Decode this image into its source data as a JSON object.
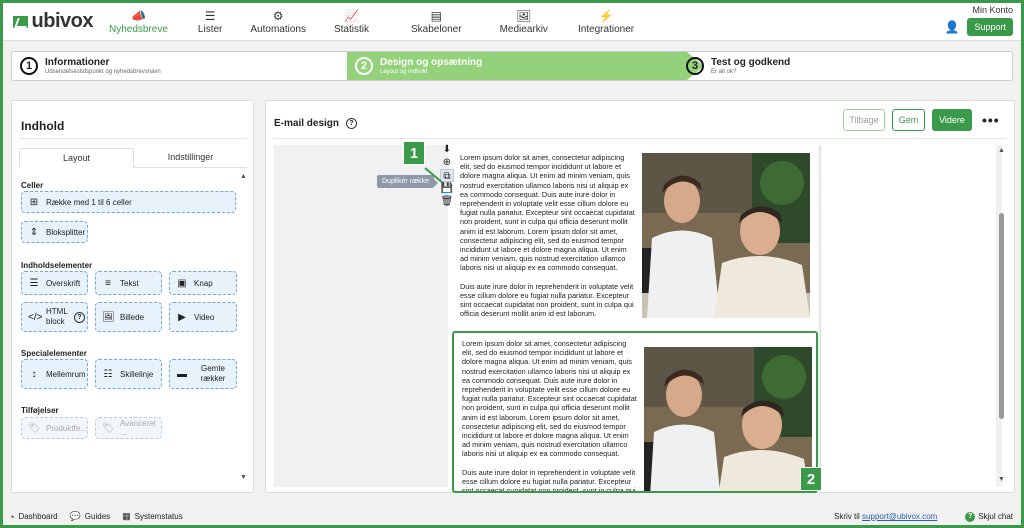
{
  "brand": {
    "name": "ubivox",
    "accent": "#3a9a4a"
  },
  "nav": {
    "items": [
      {
        "label": "Nyhedsbreve",
        "icon": "megaphone-icon",
        "active": true
      },
      {
        "label": "Lister",
        "icon": "list-icon"
      },
      {
        "label": "Automations",
        "icon": "cogs-icon"
      },
      {
        "label": "Statistik",
        "icon": "chart-icon"
      },
      {
        "label": "Skabeloner",
        "icon": "template-icon"
      },
      {
        "label": "Mediearkiv",
        "icon": "image-icon"
      },
      {
        "label": "Integrationer",
        "icon": "plug-icon"
      }
    ],
    "account_label": "Min Konto",
    "support_label": "Support"
  },
  "stepper": {
    "steps": [
      {
        "num": "1",
        "title": "Informationer",
        "sub": "Udsendelsestidspunkt og nyhedsbrevsnavn"
      },
      {
        "num": "2",
        "title": "Design og opsætning",
        "sub": "Layout og indhold",
        "active": true
      },
      {
        "num": "3",
        "title": "Test og godkend",
        "sub": "Er alt ok?"
      }
    ]
  },
  "left": {
    "title": "Indhold",
    "tabs": [
      "Layout",
      "Indstillinger"
    ],
    "sections": {
      "celler": "Celler",
      "indhold": "Indholdselementer",
      "special": "Specialelementer",
      "tilfoejelser": "Tilføjelser"
    },
    "blocks": {
      "row_cells": "Række med 1 til 6 celler",
      "blocksplitter": "Bloksplitter",
      "heading": "Overskrift",
      "text": "Tekst",
      "button": "Knap",
      "html_block": "HTML block",
      "image": "Billede",
      "video": "Video",
      "spacing": "Mellemrum",
      "divider": "Skillelinje",
      "saved_rows": "Gemte rækker",
      "product_feed": "Produktfe...",
      "advanced": "Avanceret ..."
    }
  },
  "right": {
    "title": "E-mail design",
    "back_label": "Tilbage",
    "save_label": "Gem",
    "next_label": "Videre",
    "more_label": "•••",
    "tooltip": "Duplikér række",
    "badge1": "1",
    "badge2": "2",
    "lorem_p1": "Lorem ipsum dolor sit amet, consectetur adipiscing elit, sed do eiusmod tempor incididunt ut labore et dolore magna aliqua. Ut enim ad minim veniam, quis nostrud exercitation ullamco laboris nisi ut aliquip ex ea commodo consequat. Duis aute irure dolor in reprehenderit in voluptate velit esse cillum dolore eu fugiat nulla pariatur. Excepteur sint occaecat cupidatat non proident, sunt in culpa qui officia deserunt mollit anim id est laborum. Lorem ipsum dolor sit amet, consectetur adipiscing elit, sed do eiusmod tempor incididunt ut labore et dolore magna aliqua. Ut enim ad minim veniam, quis nostrud exercitation ullamco laboris nisi ut aliquip ex ea commodo consequat.",
    "lorem_p2": "Duis aute irure dolor in reprehenderit in voluptate velit esse cillum dolore eu fugiat nulla pariatur. Excepteur sint occaecat cupidatat non proident, sunt in culpa qui officia deserunt mollit anim id est laborum."
  },
  "bottom": {
    "dashboard": "Dashboard",
    "guides": "Guides",
    "systemstatus": "Systemstatus",
    "write_to": "Skriv til",
    "email": "support@ubivox.com",
    "hide_chat": "Skjul chat"
  }
}
